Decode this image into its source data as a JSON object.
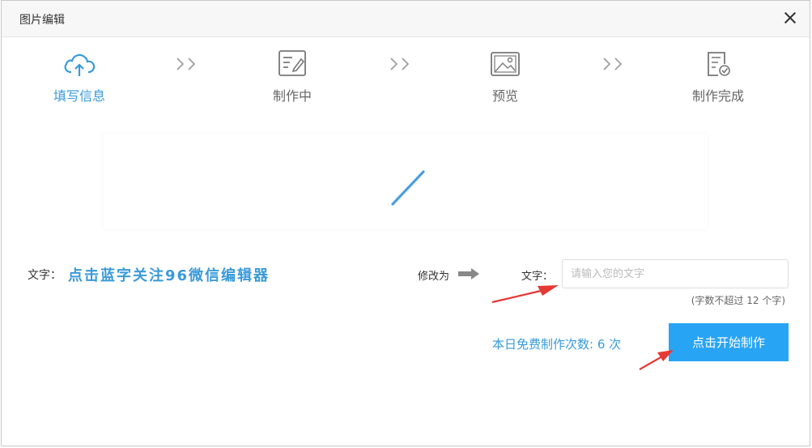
{
  "dialog": {
    "title": "图片编辑"
  },
  "steps": [
    {
      "label": "填写信息",
      "icon": "cloud-upload-icon",
      "active": true
    },
    {
      "label": "制作中",
      "icon": "edit-document-icon",
      "active": false
    },
    {
      "label": "预览",
      "icon": "image-icon",
      "active": false
    },
    {
      "label": "制作完成",
      "icon": "document-check-icon",
      "active": false
    }
  ],
  "form": {
    "source_label": "文字：",
    "source_text": "点击蓝字关注96微信编辑器",
    "modify_label": "修改为",
    "target_label": "文字：",
    "target_placeholder": "请输入您的文字",
    "target_value": "",
    "hint": "(字数不超过 12 个字)"
  },
  "quota": {
    "text": "本日免费制作次数: 6 次"
  },
  "actions": {
    "start_label": "点击开始制作"
  },
  "colors": {
    "accent": "#3a9ad9",
    "button": "#28a4f5",
    "annotation": "#e53935"
  }
}
